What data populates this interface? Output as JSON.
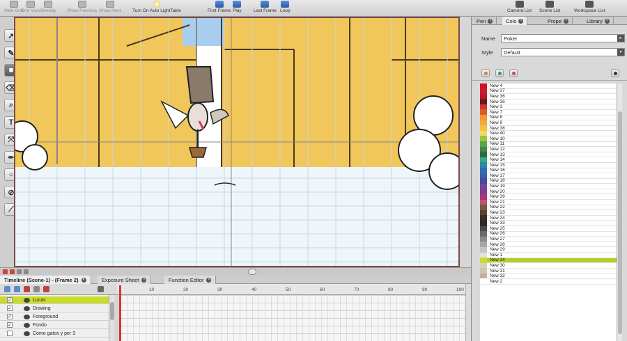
{
  "toolbar": {
    "items": [
      {
        "label": "Hide Grid",
        "icon": "grid-icon",
        "dim": true
      },
      {
        "label": "Grid View",
        "icon": "grid-view-icon",
        "dim": true
      },
      {
        "label": "Overlay",
        "icon": "overlay-icon",
        "dim": true
      },
      {
        "label": "Show Previous",
        "icon": "onion-prev-icon",
        "dim": true
      },
      {
        "label": "Show Next",
        "icon": "onion-next-icon",
        "dim": true
      },
      {
        "label": "Turn On Auto LightTable",
        "icon": "light-bulb-icon",
        "dim": false
      },
      {
        "label": "First Frame",
        "icon": "first-frame-icon",
        "dim": false
      },
      {
        "label": "Play",
        "icon": "play-icon",
        "dim": false
      },
      {
        "label": "Last Frame",
        "icon": "last-frame-icon",
        "dim": false
      },
      {
        "label": "Loop",
        "icon": "loop-icon",
        "dim": false
      },
      {
        "label": "Camera List",
        "icon": "camera-list-icon",
        "dim": false
      },
      {
        "label": "Scene List",
        "icon": "scene-list-icon",
        "dim": false
      },
      {
        "label": "Workspace List",
        "icon": "workspace-list-icon",
        "dim": false
      }
    ]
  },
  "tools": [
    "select-tool",
    "brush-tool",
    "paint-tool",
    "eraser-tool",
    "zoom-tool",
    "text-tool",
    "contour-editor-tool",
    "dropper-tool",
    "ellipse-tool",
    "paint-unpainted-tool",
    "stroke-tool"
  ],
  "timeline": {
    "tabs": [
      {
        "label": "Timeline (Scene-1) - (Frame 2)",
        "active": true
      },
      {
        "label": "Exposure Sheet",
        "active": false
      },
      {
        "label": "Function Editor",
        "active": false
      }
    ],
    "ruler": [
      "10",
      "20",
      "30",
      "40",
      "50",
      "60",
      "70",
      "80",
      "90",
      "100"
    ],
    "layers": [
      {
        "name": "Lucas",
        "checked": true,
        "selected": true
      },
      {
        "name": "Drawing",
        "checked": true,
        "selected": false
      },
      {
        "name": "Foreground",
        "checked": true,
        "selected": false
      },
      {
        "name": "Fondo",
        "checked": true,
        "selected": false
      },
      {
        "name": "Como gatos y per 3",
        "checked": false,
        "selected": false
      }
    ]
  },
  "right_panel": {
    "tabs": [
      {
        "label": "Pen",
        "active": false
      },
      {
        "label": "Colo",
        "active": true
      },
      {
        "label": "Prope",
        "active": false
      },
      {
        "label": "Library",
        "active": false
      }
    ],
    "name_label": "Name",
    "name_value": "Poker",
    "style_label": "Style",
    "style_value": "Default",
    "swatches": [
      {
        "name": "New 4",
        "color": "#c9102c"
      },
      {
        "name": "New 37",
        "color": "#d41a2a"
      },
      {
        "name": "New 36",
        "color": "#b81a2e"
      },
      {
        "name": "New 35",
        "color": "#6b1b1f"
      },
      {
        "name": "New 3",
        "color": "#c83a2a"
      },
      {
        "name": "New 7",
        "color": "#e4572b"
      },
      {
        "name": "New 8",
        "color": "#ee9a2e"
      },
      {
        "name": "New 9",
        "color": "#f2a93a"
      },
      {
        "name": "New 38",
        "color": "#f4c23f"
      },
      {
        "name": "New 40",
        "color": "#f5d66a"
      },
      {
        "name": "New 10",
        "color": "#9ec43a"
      },
      {
        "name": "New 11",
        "color": "#5aa84a"
      },
      {
        "name": "New 12",
        "color": "#3d8a4a"
      },
      {
        "name": "New 13",
        "color": "#2f6b3d"
      },
      {
        "name": "New 14",
        "color": "#3aa68a"
      },
      {
        "name": "New 15",
        "color": "#2c8a9c"
      },
      {
        "name": "New 16",
        "color": "#2a6fb0"
      },
      {
        "name": "New 17",
        "color": "#3b5fa8"
      },
      {
        "name": "New 18",
        "color": "#4a4a9a"
      },
      {
        "name": "New 19",
        "color": "#6a4a9a"
      },
      {
        "name": "New 20",
        "color": "#8a3a8a"
      },
      {
        "name": "New 39",
        "color": "#a23a7a"
      },
      {
        "name": "New 21",
        "color": "#c4527a"
      },
      {
        "name": "New 22",
        "color": "#7a5a3a"
      },
      {
        "name": "New 23",
        "color": "#5a4230"
      },
      {
        "name": "New 24",
        "color": "#3a2e25"
      },
      {
        "name": "New 33",
        "color": "#2a2a2a"
      },
      {
        "name": "New 25",
        "color": "#4a4a4a"
      },
      {
        "name": "New 26",
        "color": "#6a6a6a"
      },
      {
        "name": "New 27",
        "color": "#8a8a8a"
      },
      {
        "name": "New 28",
        "color": "#a6a6a6"
      },
      {
        "name": "New 29",
        "color": "#c4c4c4"
      },
      {
        "name": "New 1",
        "color": "#e0e0e0"
      },
      {
        "name": "New 34",
        "color": "#c9dc2a",
        "selected": true
      },
      {
        "name": "New 30",
        "color": "#d8d0c0"
      },
      {
        "name": "New 31",
        "color": "#cfc5b0"
      },
      {
        "name": "New 32",
        "color": "#bfb49a"
      },
      {
        "name": "New 2",
        "color": "#ffffff"
      }
    ]
  }
}
